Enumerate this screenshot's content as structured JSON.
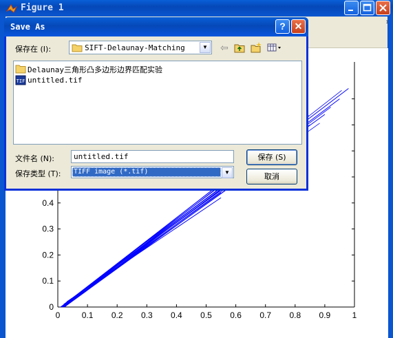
{
  "figure": {
    "title": "Figure 1",
    "menu_chevron": "»"
  },
  "plot": {
    "line_color": "#0000ff",
    "x_ticks": [
      "0",
      "0.1",
      "0.2",
      "0.3",
      "0.4",
      "0.5",
      "0.6",
      "0.7",
      "0.8",
      "0.9",
      "1"
    ],
    "y_ticks_visible": [
      "0",
      "0.1",
      "0.2",
      "0.3",
      "0.4"
    ]
  },
  "chart_data": {
    "type": "line",
    "title": "",
    "xlabel": "",
    "ylabel": "",
    "xlim": [
      0,
      1
    ],
    "ylim": [
      0,
      0.85
    ],
    "note_series": "fan of many blue line segments from near origin to upper right",
    "series": [
      {
        "x": [
          0.01,
          0.98
        ],
        "y": [
          0.0,
          0.84
        ]
      },
      {
        "x": [
          0.01,
          0.95
        ],
        "y": [
          0.0,
          0.8
        ]
      },
      {
        "x": [
          0.02,
          0.9
        ],
        "y": [
          0.01,
          0.74
        ]
      },
      {
        "x": [
          0.02,
          0.85
        ],
        "y": [
          0.01,
          0.7
        ]
      },
      {
        "x": [
          0.03,
          0.75
        ],
        "y": [
          0.01,
          0.61
        ]
      },
      {
        "x": [
          0.02,
          0.6
        ],
        "y": [
          0.01,
          0.49
        ]
      },
      {
        "x": [
          0.03,
          0.55
        ],
        "y": [
          0.02,
          0.42
        ]
      }
    ]
  },
  "dialog": {
    "title": "Save As",
    "help_glyph": "?",
    "close_glyph": "✕",
    "save_in_label": "保存在 (I):",
    "save_in_value": "SIFT-Delaunay-Matching",
    "files": [
      {
        "name": "Delaunay三角形凸多边形边界匹配实验",
        "kind": "folder"
      },
      {
        "name": "untitled.tif",
        "kind": "tif"
      }
    ],
    "tif_icon_text": "TIF",
    "filename_label": "文件名 (N):",
    "filename_value": "untitled.tif",
    "filetype_label": "保存类型 (T):",
    "filetype_value": "TIFF image (*.tif)",
    "save_button": "保存 (S)",
    "cancel_button": "取消",
    "dropdown_arrow": "▼",
    "back_icon_glyph": "⇦"
  }
}
